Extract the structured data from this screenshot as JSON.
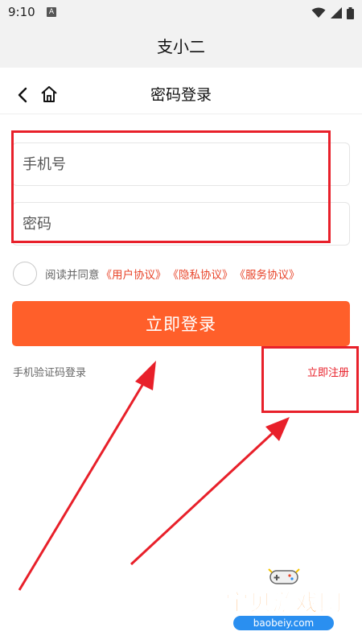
{
  "status_bar": {
    "time": "9:10",
    "notification_letter": "A"
  },
  "app": {
    "title": "支小二"
  },
  "nav": {
    "title": "密码登录"
  },
  "form": {
    "phone_placeholder": "手机号",
    "password_placeholder": "密码"
  },
  "agreement": {
    "prefix": "阅读并同意",
    "links": [
      "《用户协议》",
      "《隐私协议》",
      "《服务协议》"
    ],
    "checked": false
  },
  "login_button": {
    "label": "立即登录"
  },
  "footer": {
    "sms_login": "手机验证码登录",
    "register": "立即注册"
  },
  "watermark": {
    "text": "宝贝游戏网",
    "url": "baobeiy.com"
  },
  "colors": {
    "accent": "#ff5f2a",
    "annotation_red": "#e8202a",
    "link_red": "#e8442a",
    "header_bg": "#f2f2f2"
  },
  "icons": [
    "back-icon",
    "home-icon",
    "wifi-icon",
    "signal-icon",
    "battery-icon"
  ]
}
